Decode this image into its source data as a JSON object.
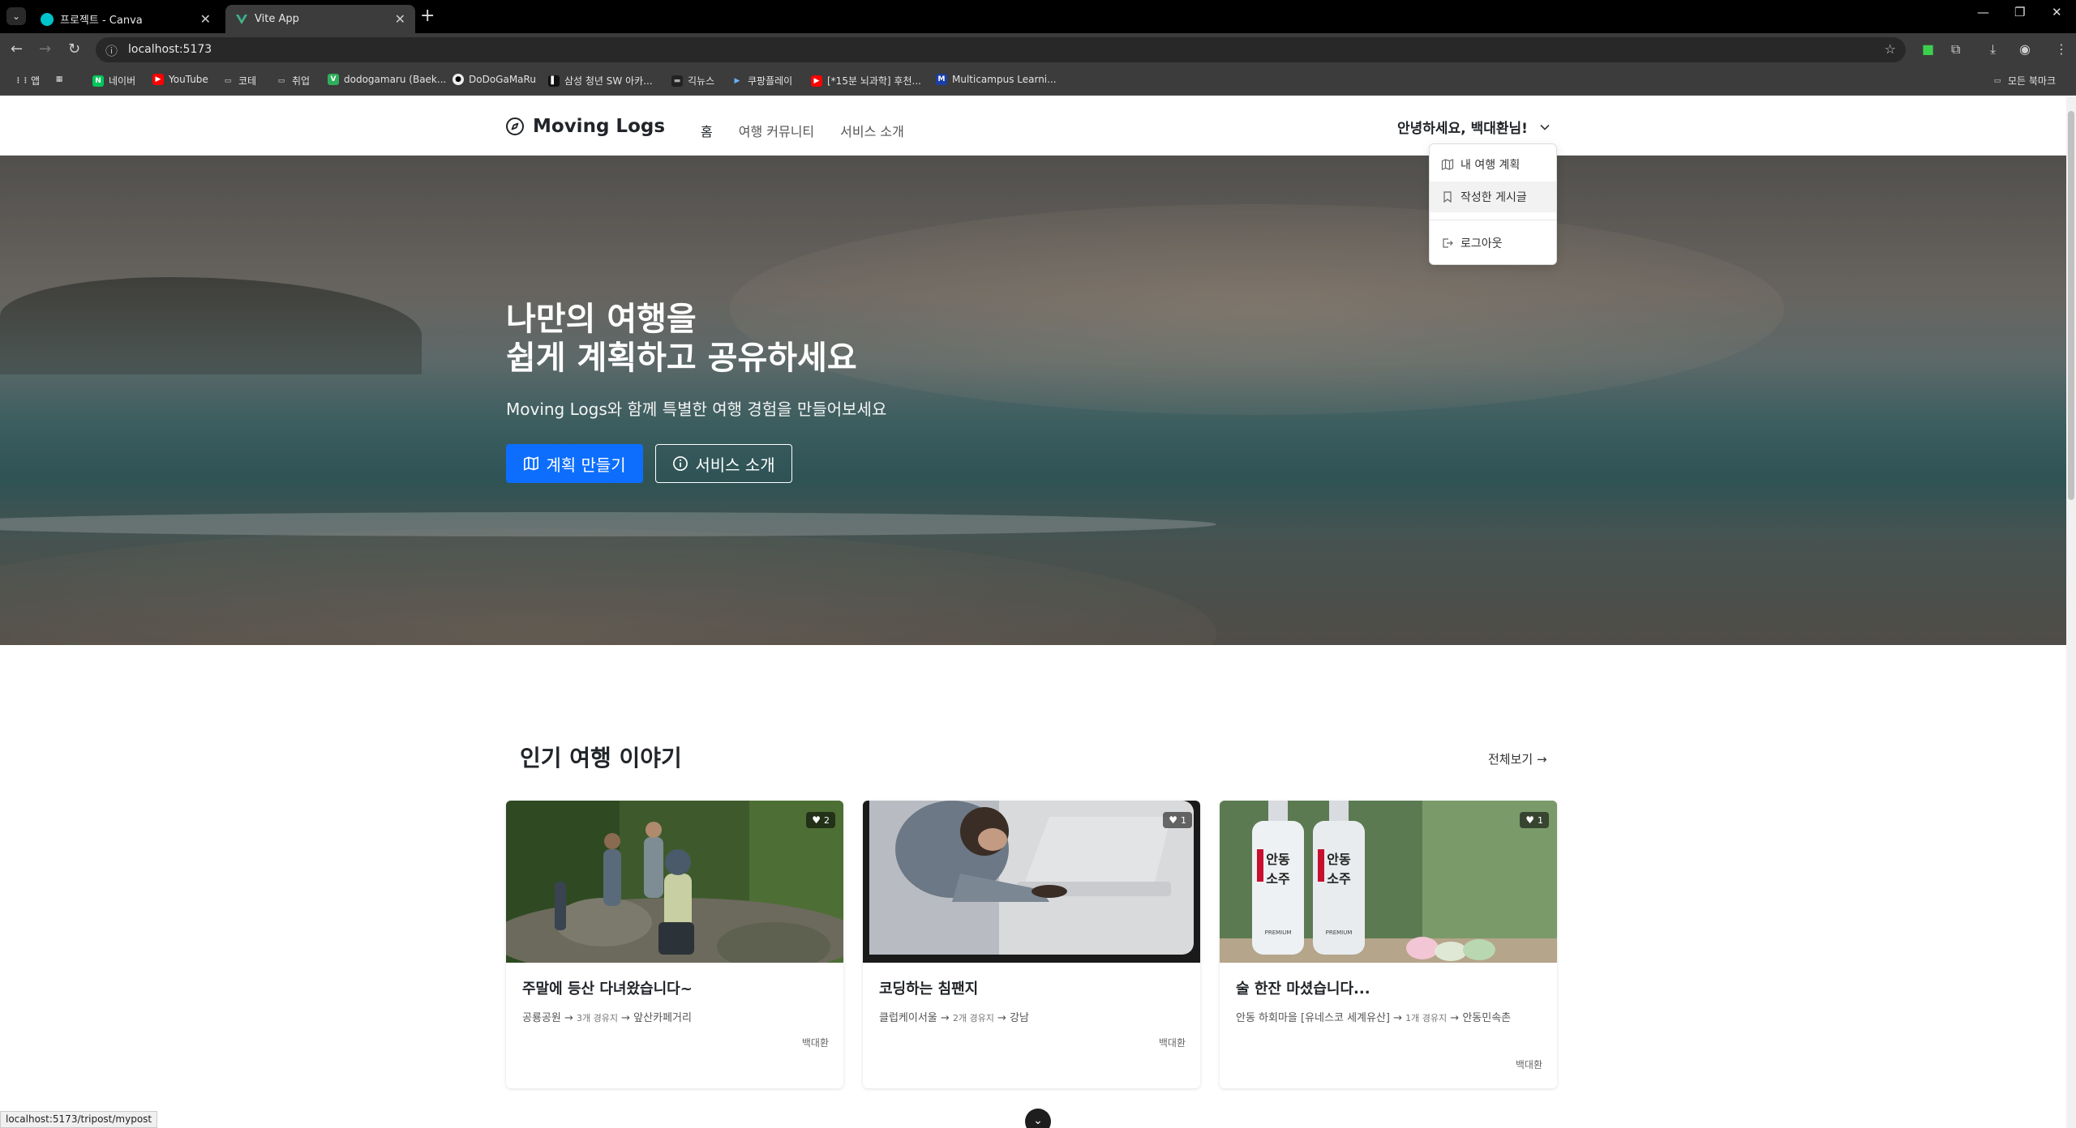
{
  "browser": {
    "tabs": [
      {
        "title": "프로젝트 - Canva",
        "active": false
      },
      {
        "title": "Vite App",
        "active": true
      }
    ],
    "url": "localhost:5173",
    "bookmarks": [
      "앱",
      "네이버",
      "YouTube",
      "코테",
      "취업",
      "dodogamaru (Baek...",
      "DoDoGaMaRu",
      "삼성 청년 SW 아카...",
      "긱뉴스",
      "쿠팡플레이",
      "[*15분 뇌과학] 후천...",
      "Multicampus Learni..."
    ],
    "all_bookmarks": "모든 북마크",
    "status_url": "localhost:5173/tripost/mypost"
  },
  "nav": {
    "brand": "Moving Logs",
    "links": [
      "홈",
      "여행 커뮤니티",
      "서비스 소개"
    ],
    "greeting": "안녕하세요, 백대환님!"
  },
  "dropdown": {
    "items": [
      "내 여행 계획",
      "작성한 게시글",
      "로그아웃"
    ]
  },
  "hero": {
    "title_line1": "나만의 여행을",
    "title_line2": "쉽게 계획하고 공유하세요",
    "subtitle": "Moving Logs와 함께 특별한 여행 경험을 만들어보세요",
    "primary_button": "계획 만들기",
    "secondary_button": "서비스 소개"
  },
  "popular": {
    "title": "인기 여행 이야기",
    "see_all": "전체보기 →",
    "cards": [
      {
        "likes": "2",
        "title": "주말에 등산 다녀왔습니다~",
        "from": "공룡공원",
        "mid": "3개 경유지",
        "to": "앞산카페거리",
        "author": "백대환"
      },
      {
        "likes": "1",
        "title": "코딩하는 침팬지",
        "from": "클럽케이서울",
        "mid": "2개 경유지",
        "to": "강남",
        "author": "백대환"
      },
      {
        "likes": "1",
        "title": "술 한잔 마셨습니다...",
        "from": "안동 하회마을 [유네스코 세계유산]",
        "mid": "1개 경유지",
        "to": "안동민속촌",
        "author": "백대환"
      }
    ]
  },
  "card3_label": "안동소주",
  "card3_label2": "PREMIUM",
  "colors": {
    "primary": "#0d6efd",
    "text": "#212529"
  }
}
